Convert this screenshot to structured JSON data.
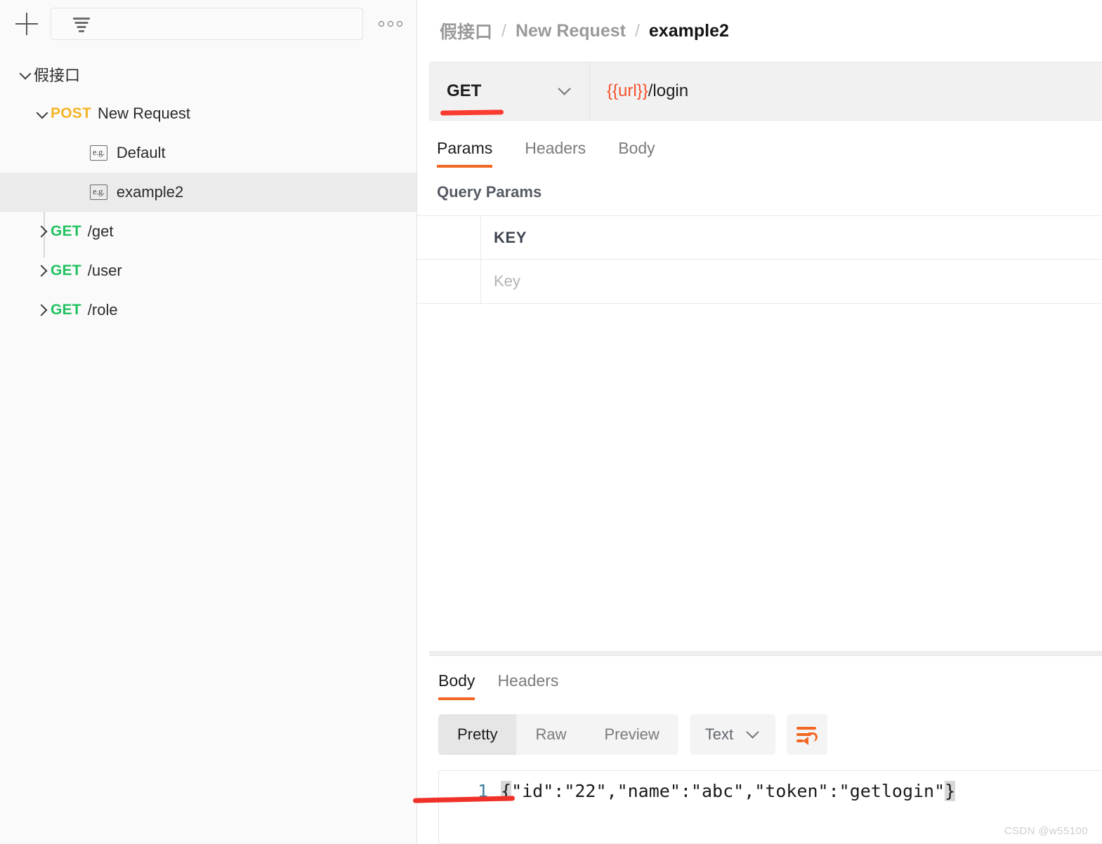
{
  "sidebar": {
    "toolbar": {
      "add_label": "+",
      "add_icon": "plus-icon",
      "filter_icon": "filter-icon",
      "search_value": "",
      "search_placeholder": "",
      "more_icon": "three-dots-icon"
    },
    "tree": [
      {
        "level": 0,
        "chevron": "down",
        "method": "",
        "label": "假接口",
        "icon": "",
        "selected": false
      },
      {
        "level": 1,
        "chevron": "down",
        "method": "POST",
        "label": "New Request",
        "icon": "",
        "selected": false
      },
      {
        "level": 2,
        "chevron": "none",
        "method": "",
        "label": "Default",
        "icon": "e.g.",
        "selected": false
      },
      {
        "level": 2,
        "chevron": "none",
        "method": "",
        "label": "example2",
        "icon": "e.g.",
        "selected": true
      },
      {
        "level": 1,
        "chevron": "right",
        "method": "GET",
        "label": "/get",
        "icon": "",
        "selected": false
      },
      {
        "level": 1,
        "chevron": "right",
        "method": "GET",
        "label": "/user",
        "icon": "",
        "selected": false
      },
      {
        "level": 1,
        "chevron": "right",
        "method": "GET",
        "label": "/role",
        "icon": "",
        "selected": false
      }
    ]
  },
  "main": {
    "breadcrumb": {
      "items": [
        "假接口",
        "New Request",
        "example2"
      ],
      "separator": "/"
    },
    "urlbar": {
      "method": "GET",
      "method_chevron": "chevron-down-icon",
      "url_variable": "{{url}}",
      "url_path": "/login",
      "annotation": "red-underline"
    },
    "request_tabs": [
      {
        "label": "Params",
        "active": true
      },
      {
        "label": "Headers",
        "active": false
      },
      {
        "label": "Body",
        "active": false
      }
    ],
    "query_params": {
      "title": "Query Params",
      "columns": [
        "",
        "KEY"
      ],
      "header_key": "KEY",
      "rows": [
        {
          "checkbox": "",
          "key_placeholder": "Key"
        }
      ]
    }
  },
  "response": {
    "tabs": [
      {
        "label": "Body",
        "active": true
      },
      {
        "label": "Headers",
        "active": false
      }
    ],
    "view_modes": [
      {
        "label": "Pretty",
        "active": true
      },
      {
        "label": "Raw",
        "active": false
      },
      {
        "label": "Preview",
        "active": false
      }
    ],
    "format_select": {
      "value": "Text",
      "chevron": "chevron-down-icon"
    },
    "wrap_button_icon": "word-wrap-icon",
    "body": {
      "line_number": "1",
      "open_brace": "{",
      "content": "\"id\":\"22\",\"name\":\"abc\",\"token\":\"getlogin\"",
      "close_brace": "}",
      "annotation": "red-underline"
    }
  },
  "watermark": "CSDN @w55100",
  "colors": {
    "accent_orange": "#f26722",
    "method_get": "#20c25f",
    "method_post": "#f5b427",
    "variable_red": "#f4512c",
    "annotation_red": "#fa3b30",
    "selected_row": "#ebebeb"
  }
}
